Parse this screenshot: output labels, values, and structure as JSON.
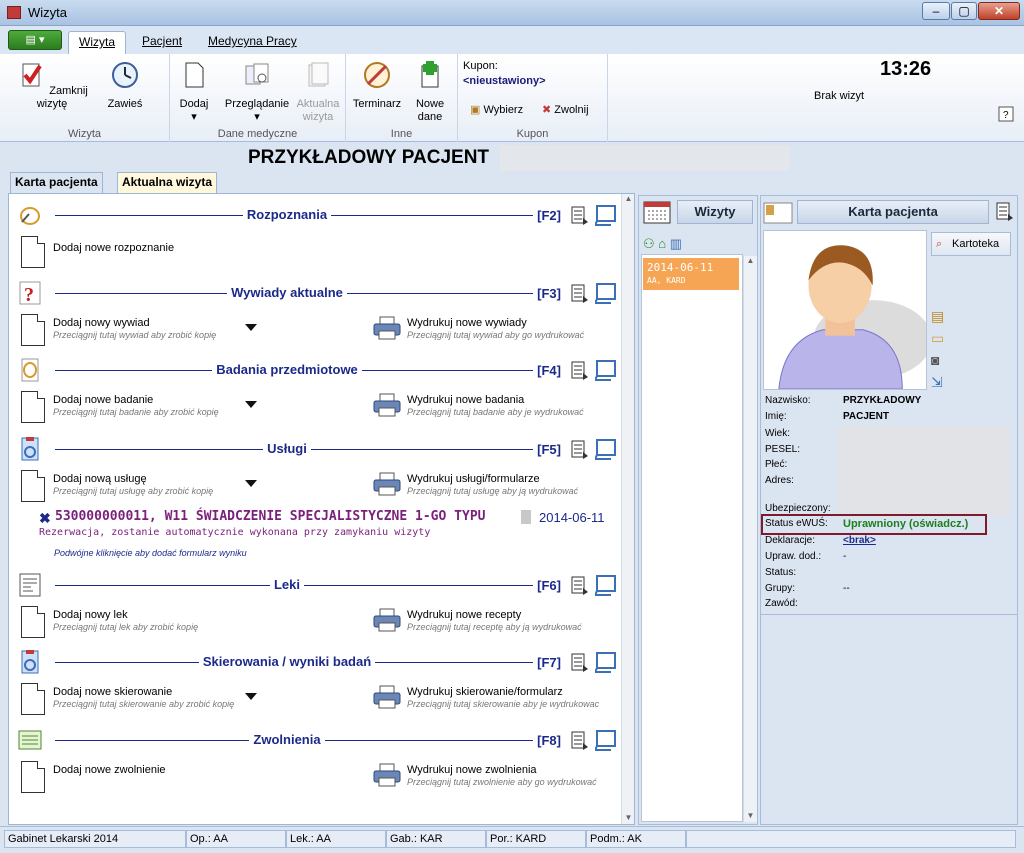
{
  "window": {
    "title": "Wizyta"
  },
  "ribbon_tabs": [
    "Wizyta",
    "Pacjent",
    "Medycyna Pracy"
  ],
  "ribbon": {
    "wizyta": {
      "group_label": "Wizyta",
      "close_label": "Zamknij wizytę",
      "suspend_label": "Zawieś"
    },
    "medical": {
      "group_label": "Dane medyczne",
      "add_label": "Dodaj",
      "browse_label": "Przeglądanie",
      "update_label": "Aktualna wizyta"
    },
    "other": {
      "group_label": "Inne",
      "schedule_label": "Terminarz",
      "newdata_label": "Nowe dane"
    },
    "kupon": {
      "group_label": "Kupon",
      "title": "Kupon:",
      "value": "<nieustawiony>",
      "choose_label": "Wybierz",
      "release_label": "Zwolnij"
    },
    "clock": "13:26",
    "no_visits": "Brak wizyt"
  },
  "patient": {
    "name": "PRZYKŁADOWY PACJENT"
  },
  "tabs": [
    "Karta pacjenta",
    "Aktualna wizyta"
  ],
  "sections": [
    {
      "title": "Rozpoznania",
      "fkey": "[F2]",
      "add_label": "Dodaj nowe rozpoznanie",
      "add_hint": "",
      "print_label": "",
      "print_hint": ""
    },
    {
      "title": "Wywiady aktualne",
      "fkey": "[F3]",
      "add_label": "Dodaj nowy wywiad",
      "add_hint": "Przeciągnij tutaj wywiad aby zrobić kopię",
      "print_label": "Wydrukuj nowe wywiady",
      "print_hint": "Przeciągnij tutaj wywiad aby go wydrukować"
    },
    {
      "title": "Badania przedmiotowe",
      "fkey": "[F4]",
      "add_label": "Dodaj nowe badanie",
      "add_hint": "Przeciągnij tutaj badanie aby zrobić kopię",
      "print_label": "Wydrukuj nowe badania",
      "print_hint": "Przeciągnij tutaj badanie aby je wydrukować"
    },
    {
      "title": "Usługi",
      "fkey": "[F5]",
      "add_label": "Dodaj nową usługę",
      "add_hint": "Przeciągnij tutaj usługę aby zrobić kopię",
      "print_label": "Wydrukuj usługi/formularze",
      "print_hint": "Przeciągnij tutaj usługę aby ją wydrukować"
    },
    {
      "title": "Leki",
      "fkey": "[F6]",
      "add_label": "Dodaj nowy lek",
      "add_hint": "Przeciągnij tutaj lek aby zrobić kopię",
      "print_label": "Wydrukuj nowe recepty",
      "print_hint": "Przeciągnij tutaj receptę aby ją wydrukować"
    },
    {
      "title": "Skierowania / wyniki badań",
      "fkey": "[F7]",
      "add_label": "Dodaj nowe skierowanie",
      "add_hint": "Przeciągnij tutaj skierowanie aby zrobić kopię",
      "print_label": "Wydrukuj skierowanie/formularz",
      "print_hint": "Przeciągnij tutaj skierowanie aby je wydrukowac"
    },
    {
      "title": "Zwolnienia",
      "fkey": "[F8]",
      "add_label": "Dodaj nowe zwolnienie",
      "add_hint": "",
      "print_label": "Wydrukuj nowe zwolnienia",
      "print_hint": "Przeciągnij tutaj zwolnienie aby go wydrukować"
    }
  ],
  "service": {
    "line": "530000000011, W11 ŚWIADCZENIE SPECJALISTYCZNE 1-GO TYPU",
    "date": "2014-06-11",
    "note": "Rezerwacja, zostanie automatycznie wykonana przy zamykaniu wizyty",
    "dblclick": "Podwójne kliknięcie aby dodać formularz wyniku"
  },
  "visits": {
    "title": "Wizyty",
    "items": [
      {
        "date": "2014-06-11",
        "sub": "AA, KARD"
      }
    ]
  },
  "card": {
    "title": "Karta pacjenta",
    "kartoteka_label": "Kartoteka",
    "fields": [
      {
        "label": "Nazwisko:",
        "value": "PRZYKŁADOWY"
      },
      {
        "label": "Imię:",
        "value": "PACJENT"
      },
      {
        "label": "Wiek:",
        "value": ""
      },
      {
        "label": "PESEL:",
        "value": ""
      },
      {
        "label": "Płeć:",
        "value": ""
      },
      {
        "label": "Adres:",
        "value": ""
      },
      {
        "label": "Ubezpieczony:",
        "value": ""
      },
      {
        "label": "Status eWUŚ:",
        "value": "Uprawniony (oświadcz.)"
      },
      {
        "label": "Deklaracje:",
        "value": "<brak>"
      },
      {
        "label": "Upraw. dod.:",
        "value": "-"
      },
      {
        "label": "Status:",
        "value": ""
      },
      {
        "label": "Grupy:",
        "value": "--"
      },
      {
        "label": "Zawód:",
        "value": ""
      }
    ]
  },
  "statusbar": [
    "Gabinet Lekarski 2014",
    "Op.: AA",
    "Lek.: AA",
    "Gab.: KAR",
    "Por.: KARD",
    "Podm.: AK"
  ],
  "colors": {
    "accent_navy": "#1b2a8a",
    "ewus_green": "#1e7d1e",
    "visit_orange": "#f6a555",
    "service_purple": "#7a1f7a"
  }
}
